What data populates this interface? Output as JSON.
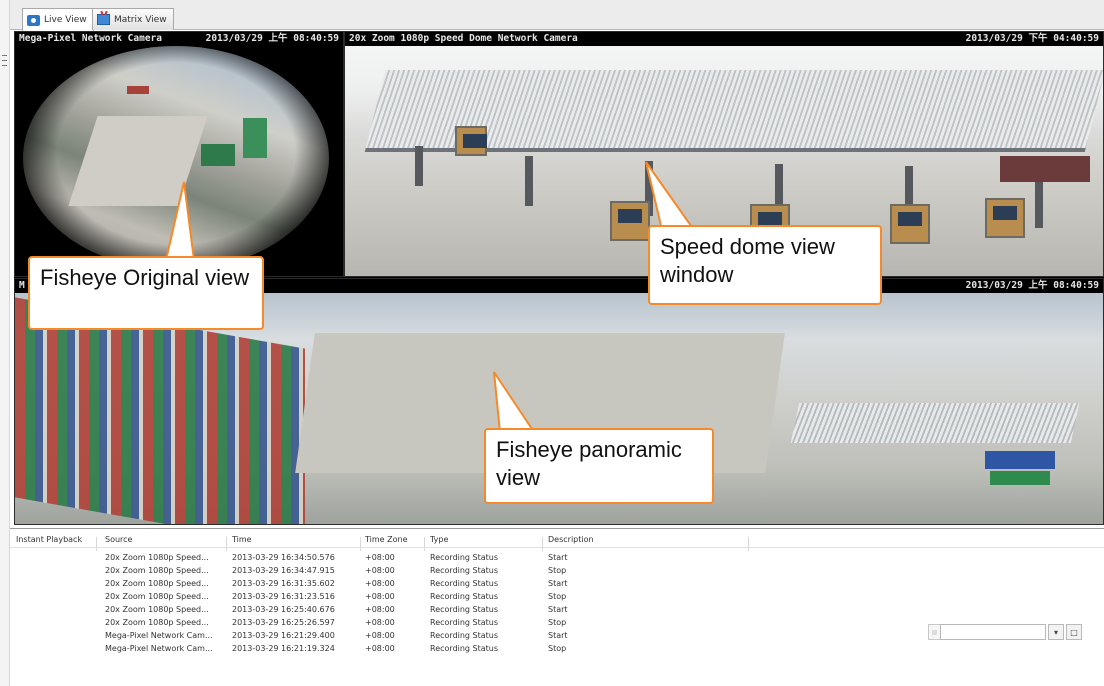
{
  "tabs": [
    {
      "label": "Live View",
      "icon": "live-view-icon",
      "active": true
    },
    {
      "label": "Matrix View",
      "icon": "matrix-view-icon",
      "active": false
    }
  ],
  "panes": {
    "fisheye_original": {
      "camera": "Mega-Pixel Network Camera",
      "timestamp": "2013/03/29 上午 08:40:59"
    },
    "speed_dome": {
      "camera": "20x Zoom 1080p Speed Dome Network Camera",
      "timestamp": "2013/03/29 下午 04:40:59"
    },
    "panoramic": {
      "camera": "M",
      "timestamp": "2013/03/29 上午 08:40:59"
    }
  },
  "callouts": {
    "fisheye_original": "Fisheye Original view",
    "speed_dome": "Speed dome view window",
    "panoramic": "Fisheye panoramic view"
  },
  "log": {
    "instant_playback": "Instant Playback",
    "columns": [
      "Source",
      "Time",
      "Time Zone",
      "Type",
      "Description"
    ],
    "rows": [
      [
        "20x Zoom 1080p Speed...",
        "2013-03-29 16:34:50.576",
        "+08:00",
        "Recording Status",
        "Start"
      ],
      [
        "20x Zoom 1080p Speed...",
        "2013-03-29 16:34:47.915",
        "+08:00",
        "Recording Status",
        "Stop"
      ],
      [
        "20x Zoom 1080p Speed...",
        "2013-03-29 16:31:35.602",
        "+08:00",
        "Recording Status",
        "Start"
      ],
      [
        "20x Zoom 1080p Speed...",
        "2013-03-29 16:31:23.516",
        "+08:00",
        "Recording Status",
        "Stop"
      ],
      [
        "20x Zoom 1080p Speed...",
        "2013-03-29 16:25:40.676",
        "+08:00",
        "Recording Status",
        "Start"
      ],
      [
        "20x Zoom 1080p Speed...",
        "2013-03-29 16:25:26.597",
        "+08:00",
        "Recording Status",
        "Stop"
      ],
      [
        "Mega-Pixel Network Cam...",
        "2013-03-29 16:21:29.400",
        "+08:00",
        "Recording Status",
        "Start"
      ],
      [
        "Mega-Pixel Network Cam...",
        "2013-03-29 16:21:19.324",
        "+08:00",
        "Recording Status",
        "Stop"
      ]
    ]
  },
  "search": {
    "value": "",
    "dropdown_glyph": "▾",
    "window_glyph": "□"
  },
  "colors": {
    "callout_border": "#f58a2a",
    "tab_icon": "#2a77c9"
  }
}
